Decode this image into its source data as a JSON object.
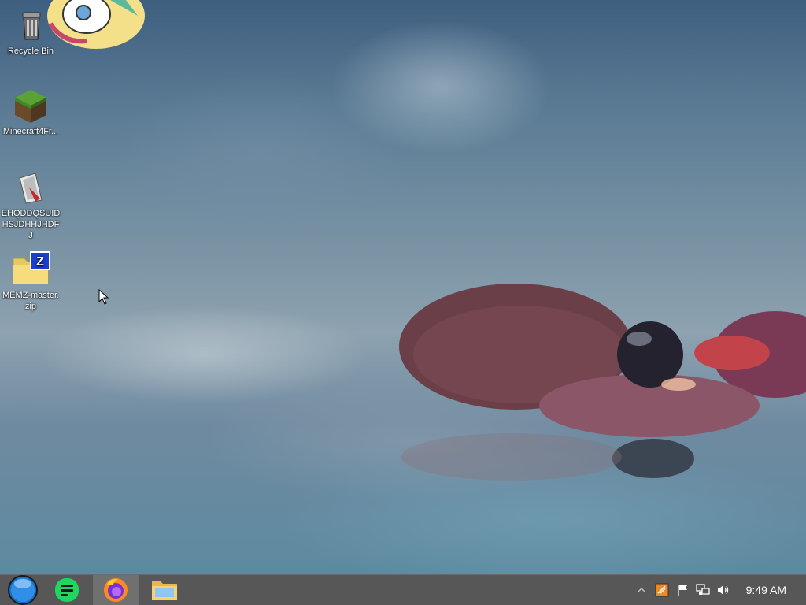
{
  "desktop": {
    "icons": [
      {
        "label": "Recycle Bin",
        "icon": "recycle-bin-icon"
      },
      {
        "label": "Minecraft4Fr...",
        "icon": "minecraft-icon"
      },
      {
        "label": "EHQDDQSUID\nHSJDHHJHDFJ\nHEIKSHEHEID",
        "icon": "executable-icon"
      },
      {
        "label": "MEMZ-master.\nzip",
        "icon": "zip-folder-icon"
      }
    ]
  },
  "taskbar": {
    "apps": [
      {
        "name": "start-orb",
        "icon": "start-orb-icon"
      },
      {
        "name": "notes-app",
        "icon": "notes-app-icon"
      },
      {
        "name": "firefox",
        "icon": "firefox-icon",
        "active": true
      },
      {
        "name": "file-explorer",
        "icon": "folder-icon"
      }
    ],
    "tray": [
      "show-hidden-icons",
      "app-tray-icon",
      "action-center-flag-icon",
      "network-icon",
      "volume-icon"
    ],
    "clock": "9:49 AM"
  },
  "colors": {
    "taskbar": "#575757",
    "active_app": "#707070",
    "notes_app": "#1ed760"
  }
}
